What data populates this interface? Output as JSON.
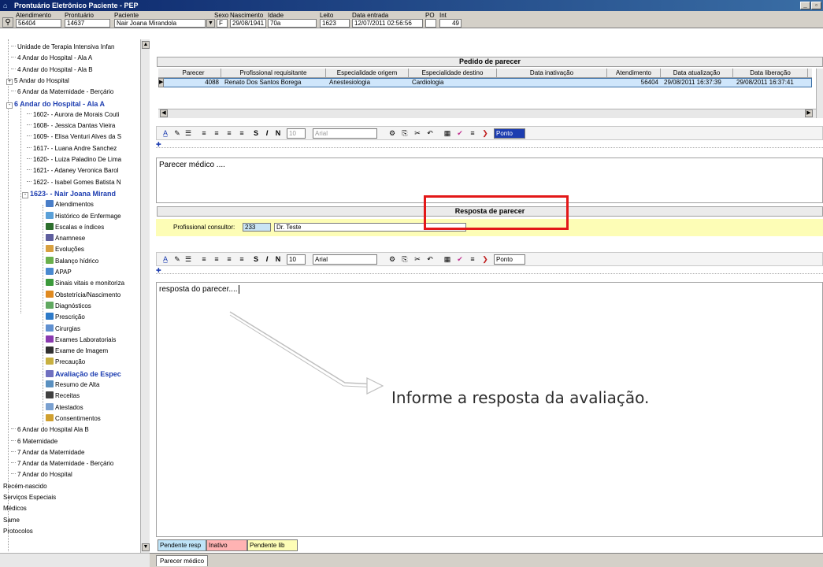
{
  "window": {
    "title": "Prontuário Eletrônico Paciente - PEP"
  },
  "patient": {
    "labels": {
      "atendimento": "Atendimento",
      "prontuario": "Prontuário",
      "paciente": "Paciente",
      "sexo": "Sexo",
      "nascimento": "Nascimento",
      "idade": "Idade",
      "leito": "Leito",
      "data_entrada": "Data entrada",
      "po": "PO",
      "int": "Int"
    },
    "values": {
      "atendimento": "56404",
      "prontuario": "14637",
      "paciente": "Nair Joana Mirandola",
      "sexo": "F",
      "nascimento": "29/08/1941",
      "idade": "70a",
      "leito": "1623",
      "data_entrada": "12/07/2011 02:56:56",
      "po": "",
      "int": "49"
    }
  },
  "sidebar": {
    "items": [
      {
        "label": "Unidade de Terapia Intensiva Infan",
        "level": 1
      },
      {
        "label": "4 Andar do Hospital - Ala A",
        "level": 1
      },
      {
        "label": "4 Andar do Hospital - Ala B",
        "level": 1
      },
      {
        "label": "5 Andar do Hospital",
        "level": 1,
        "expander": "+"
      },
      {
        "label": "6 Andar da Maternidade - Berçário",
        "level": 1
      },
      {
        "label": "6 Andar do Hospital - Ala A",
        "level": 1,
        "expander": "-",
        "bold": true
      },
      {
        "label": "1602- - Aurora de Morais Couti",
        "level": 2
      },
      {
        "label": "1608- - Jessica Dantas Vieira",
        "level": 2
      },
      {
        "label": "1609- - Elisa Venturi Alves da S",
        "level": 2
      },
      {
        "label": "1617- - Luana Andre Sanchez",
        "level": 2
      },
      {
        "label": "1620- - Luiza Paladino De Lima",
        "level": 2
      },
      {
        "label": "1621- - Adaney Veronica Barol",
        "level": 2
      },
      {
        "label": "1622- - Isabel Gomes Batista N",
        "level": 2
      },
      {
        "label": "1623- - Nair Joana Mirand",
        "level": 2,
        "expander": "-",
        "bold": true
      },
      {
        "label": "Atendimentos",
        "level": 3,
        "icon": "search-icon",
        "color": "#4a7ec8"
      },
      {
        "label": "Histórico de Enfermage",
        "level": 3,
        "icon": "nursing-history-icon",
        "color": "#5aa0d8"
      },
      {
        "label": "Escalas e índices",
        "level": 3,
        "icon": "scales-icon",
        "color": "#2c6e2c"
      },
      {
        "label": "Anamnese",
        "level": 3,
        "icon": "anamnesis-icon",
        "color": "#5e5e9e"
      },
      {
        "label": "Evoluções",
        "level": 3,
        "icon": "evolution-icon",
        "color": "#d8a040"
      },
      {
        "label": "Balanço hídrico",
        "level": 3,
        "icon": "water-balance-icon",
        "color": "#6ab04c"
      },
      {
        "label": "APAP",
        "level": 3,
        "icon": "apap-icon",
        "color": "#4a8ad0"
      },
      {
        "label": "Sinais vitais e monitoriza",
        "level": 3,
        "icon": "vital-signs-icon",
        "color": "#3c9a3c"
      },
      {
        "label": "Obstetrícia/Nascimento",
        "level": 3,
        "icon": "obstetrics-icon",
        "color": "#e08a20"
      },
      {
        "label": "Diagnósticos",
        "level": 3,
        "icon": "diagnosis-icon",
        "color": "#60a860"
      },
      {
        "label": "Prescrição",
        "level": 3,
        "icon": "prescription-icon",
        "color": "#2e7ac8"
      },
      {
        "label": "Cirurgias",
        "level": 3,
        "icon": "surgery-icon",
        "color": "#6090d0"
      },
      {
        "label": "Exames Laboratoriais",
        "level": 3,
        "icon": "lab-exam-icon",
        "color": "#8a3ab0"
      },
      {
        "label": "Exame de Imagem",
        "level": 3,
        "icon": "imaging-icon",
        "color": "#303030"
      },
      {
        "label": "Precaução",
        "level": 3,
        "icon": "precaution-icon",
        "color": "#c8b040"
      },
      {
        "label": "Avaliação de Espec",
        "level": 3,
        "icon": "specialist-evaluation-icon",
        "color": "#7070c0",
        "bold": true
      },
      {
        "label": "Resumo de Alta",
        "level": 3,
        "icon": "discharge-summary-icon",
        "color": "#5a90c0"
      },
      {
        "label": "Receitas",
        "level": 3,
        "icon": "prescriptions-icon",
        "color": "#404040"
      },
      {
        "label": "Atestados",
        "level": 3,
        "icon": "certificate-icon",
        "color": "#7aa0d0"
      },
      {
        "label": "Consentimentos",
        "level": 3,
        "icon": "consent-icon",
        "color": "#d0a030"
      },
      {
        "label": "6 Andar do Hospital Ala B",
        "level": 1
      },
      {
        "label": "6 Maternidade",
        "level": 1
      },
      {
        "label": "7 Andar da Maternidade",
        "level": 1
      },
      {
        "label": "7 Andar da Maternidade - Berçário",
        "level": 1
      },
      {
        "label": "7 Andar do Hospital",
        "level": 1
      },
      {
        "label": "Recém-nascido",
        "level": 0
      },
      {
        "label": "Serviços Especiais",
        "level": 0
      },
      {
        "label": "Médicos",
        "level": 0
      },
      {
        "label": "Same",
        "level": 0
      },
      {
        "label": "Protocolos",
        "level": 0
      }
    ]
  },
  "request": {
    "title": "Pedido de parecer",
    "columns": [
      "Parecer",
      "Profissional requisitante",
      "Especialidade origem",
      "Especialidade destino",
      "Data inativação",
      "Atendimento",
      "Data atualização",
      "Data liberação"
    ],
    "rows": [
      [
        "4088",
        "Renato Dos Santos Borega",
        "Anestesiologia",
        "Cardiologia",
        "",
        "56404",
        "29/08/2011 16:37:39",
        "29/08/2011 16:37:41"
      ]
    ],
    "editor_text": "Parecer médico ...."
  },
  "toolbar": {
    "font_size": "10",
    "font_name": "Arial",
    "style": "Ponto",
    "bold_label": "N",
    "italic_label": "I",
    "underline_label": "S"
  },
  "response": {
    "title": "Resposta de parecer",
    "consultant_label": "Profissional consultor:",
    "consultant_code": "233",
    "consultant_name": "Dr. Teste",
    "editor_text": "resposta do parecer....",
    "annotation": "Informe a resposta da avaliação."
  },
  "legend": [
    {
      "label": "Pendente resp",
      "color": "#bfe4f8"
    },
    {
      "label": "Inativo",
      "color": "#ffb3b3"
    },
    {
      "label": "Pendente lib",
      "color": "#fdfdb6"
    }
  ],
  "bottom_tab": "Parecer médico"
}
